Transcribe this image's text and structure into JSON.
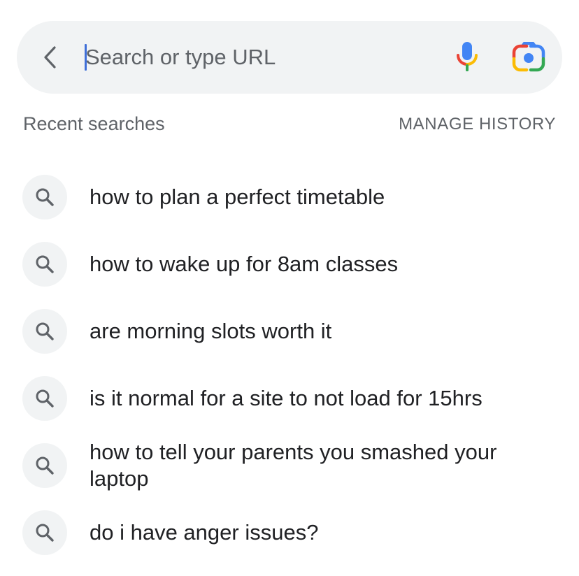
{
  "search": {
    "placeholder": "Search or type URL",
    "value": ""
  },
  "icons": {
    "back": "back-arrow-icon",
    "mic": "microphone-icon",
    "lens": "google-lens-icon",
    "result": "search-icon"
  },
  "colors": {
    "search_bar_bg": "#f1f3f4",
    "caret": "#3f6fd8",
    "google_blue": "#4285f4",
    "google_red": "#ea4335",
    "google_yellow": "#fbbc05",
    "google_green": "#34a853",
    "secondary_text": "#5f6368",
    "primary_text": "#202124"
  },
  "recent": {
    "title": "Recent searches",
    "manage_label": "MANAGE HISTORY",
    "items": [
      {
        "text": "how to plan a perfect timetable"
      },
      {
        "text": "how to wake up for 8am classes"
      },
      {
        "text": "are morning slots worth it"
      },
      {
        "text": "is it normal for a site to not load for 15hrs"
      },
      {
        "text": "how to tell your parents you smashed your laptop"
      },
      {
        "text": "do i have anger issues?"
      }
    ]
  }
}
